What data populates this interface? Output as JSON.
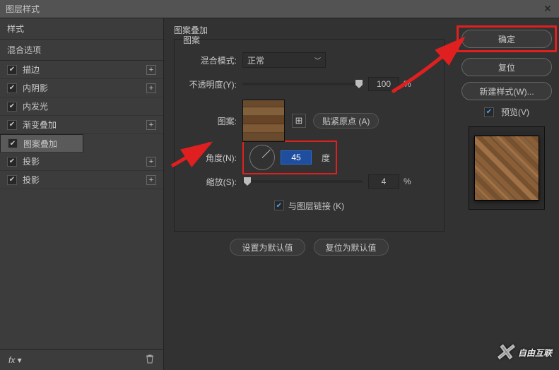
{
  "window": {
    "title": "图层样式"
  },
  "sidebar": {
    "header": "样式",
    "subheader": "混合选项",
    "items": [
      {
        "label": "描边"
      },
      {
        "label": "内阴影"
      },
      {
        "label": "内发光"
      },
      {
        "label": "渐变叠加"
      },
      {
        "label": "图案叠加"
      },
      {
        "label": "投影"
      },
      {
        "label": "投影"
      }
    ],
    "fx": "fx"
  },
  "panel": {
    "title": "图案叠加",
    "group": "图案",
    "blend_label": "混合模式:",
    "blend_value": "正常",
    "opacity_label": "不透明度(Y):",
    "opacity_value": "100",
    "opacity_unit": "%",
    "pattern_label": "图案:",
    "snap_label": "贴紧原点 (A)",
    "angle_label": "角度(N):",
    "angle_value": "45",
    "angle_unit": "度",
    "scale_label": "缩放(S):",
    "scale_value": "4",
    "scale_unit": "%",
    "link_label": "与图层链接 (K)",
    "set_default": "设置为默认值",
    "reset_default": "复位为默认值"
  },
  "right": {
    "ok": "确定",
    "reset": "复位",
    "newstyle": "新建样式(W)...",
    "preview": "预览(V)"
  },
  "watermark": "自由互联"
}
